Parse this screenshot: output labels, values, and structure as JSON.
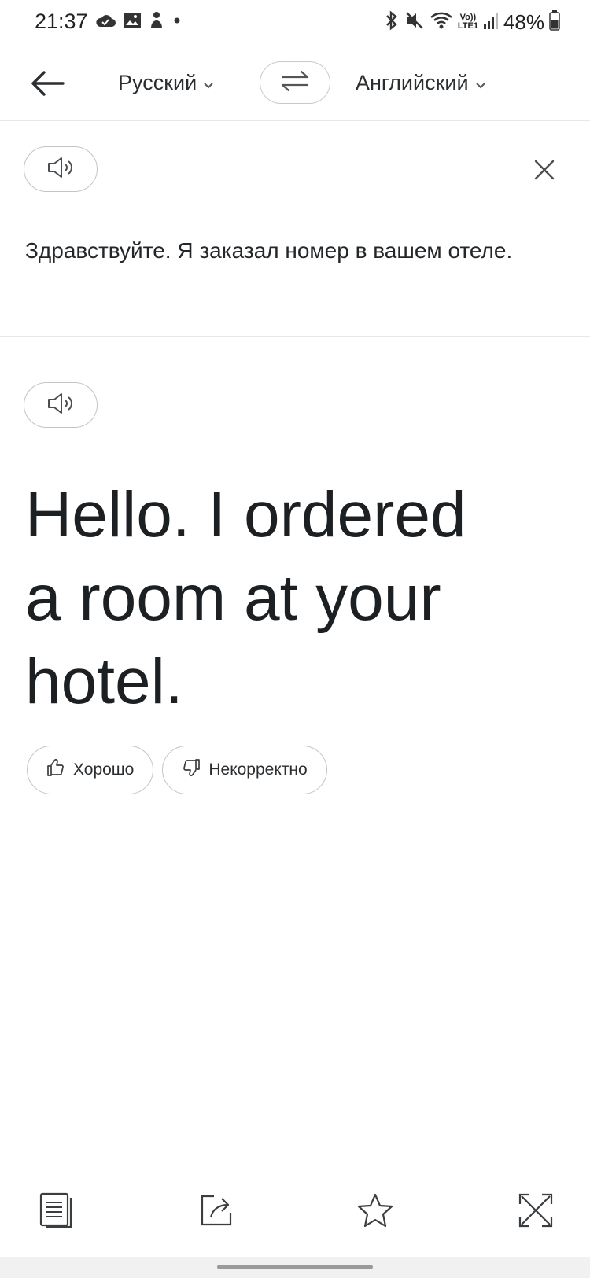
{
  "status_bar": {
    "time": "21:37",
    "left_icons": [
      "cloud-icon",
      "image-icon",
      "notification-icon",
      "dot-icon"
    ],
    "right_icons": [
      "bluetooth-icon",
      "mute-icon",
      "wifi-icon",
      "volte-icon",
      "signal-icon"
    ],
    "volte_top": "Vo))",
    "volte_bottom": "LTE1",
    "battery_text": "48%"
  },
  "toolbar": {
    "source_language": "Русский",
    "target_language": "Английский",
    "back_icon": "arrow-left-icon",
    "swap_icon": "swap-icon"
  },
  "source": {
    "text": "Здравствуйте. Я заказал номер в вашем отеле.",
    "speak_icon": "speaker-icon",
    "close_icon": "close-icon"
  },
  "translation": {
    "text": "Hello. I ordered a room at your hotel.",
    "speak_icon": "speaker-icon"
  },
  "feedback": {
    "good_label": "Хорошо",
    "bad_label": "Некорректно"
  },
  "bottom_bar": {
    "icons": [
      "copy-icon",
      "share-icon",
      "star-icon",
      "fullscreen-icon"
    ]
  }
}
